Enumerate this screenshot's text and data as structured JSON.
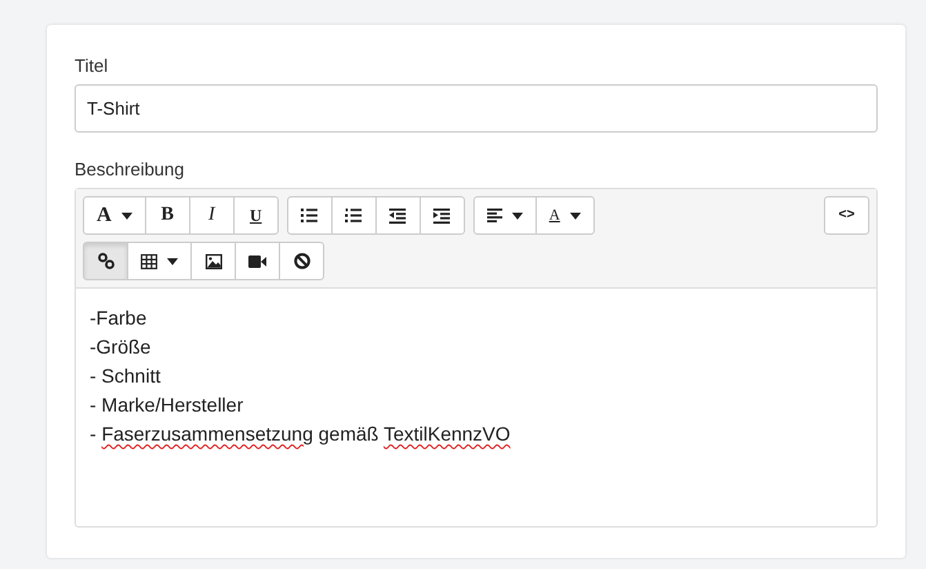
{
  "fields": [
    {
      "kind": "text",
      "label": "Titel",
      "value": "T-Shirt"
    }
  ],
  "editor": {
    "label": "Beschreibung",
    "toolbar": [
      {
        "groups": [
          {
            "tools": [
              {
                "kind": "font",
                "label": "A",
                "dropdown": true,
                "pressed": false
              },
              {
                "kind": "bold",
                "label": "B",
                "dropdown": false,
                "pressed": false
              },
              {
                "kind": "italic",
                "label": "I",
                "dropdown": false,
                "pressed": false
              },
              {
                "kind": "underline",
                "label": "U",
                "dropdown": false,
                "pressed": false
              }
            ]
          },
          {
            "tools": [
              {
                "kind": "ul",
                "dropdown": false,
                "pressed": false
              },
              {
                "kind": "ol",
                "dropdown": false,
                "pressed": false
              },
              {
                "kind": "outdent",
                "dropdown": false,
                "pressed": false
              },
              {
                "kind": "indent",
                "dropdown": false,
                "pressed": false
              }
            ]
          },
          {
            "tools": [
              {
                "kind": "align",
                "dropdown": true,
                "pressed": false
              },
              {
                "kind": "color",
                "label": "A",
                "dropdown": true,
                "pressed": false
              }
            ]
          }
        ],
        "end_groups": [
          {
            "tools": [
              {
                "kind": "code",
                "label": "<>",
                "dropdown": false,
                "pressed": false
              }
            ]
          }
        ]
      },
      {
        "groups": [
          {
            "tools": [
              {
                "kind": "link",
                "dropdown": false,
                "pressed": true
              },
              {
                "kind": "table",
                "dropdown": true,
                "pressed": false
              },
              {
                "kind": "image",
                "dropdown": false,
                "pressed": false
              },
              {
                "kind": "video",
                "dropdown": false,
                "pressed": false
              },
              {
                "kind": "clear",
                "dropdown": false,
                "pressed": false
              }
            ]
          }
        ]
      }
    ],
    "lines": [
      [
        {
          "text": "-Farbe",
          "misspelled": false
        }
      ],
      [
        {
          "text": "-Größe",
          "misspelled": false
        }
      ],
      [
        {
          "text": "- Schnitt",
          "misspelled": false
        }
      ],
      [
        {
          "text": "- Marke/Hersteller",
          "misspelled": false
        }
      ],
      [
        {
          "text": "- ",
          "misspelled": false
        },
        {
          "text": "Faserzusammensetzung",
          "misspelled": true
        },
        {
          "text": " gemäß ",
          "misspelled": false
        },
        {
          "text": "TextilKennzVO",
          "misspelled": true
        }
      ]
    ]
  }
}
